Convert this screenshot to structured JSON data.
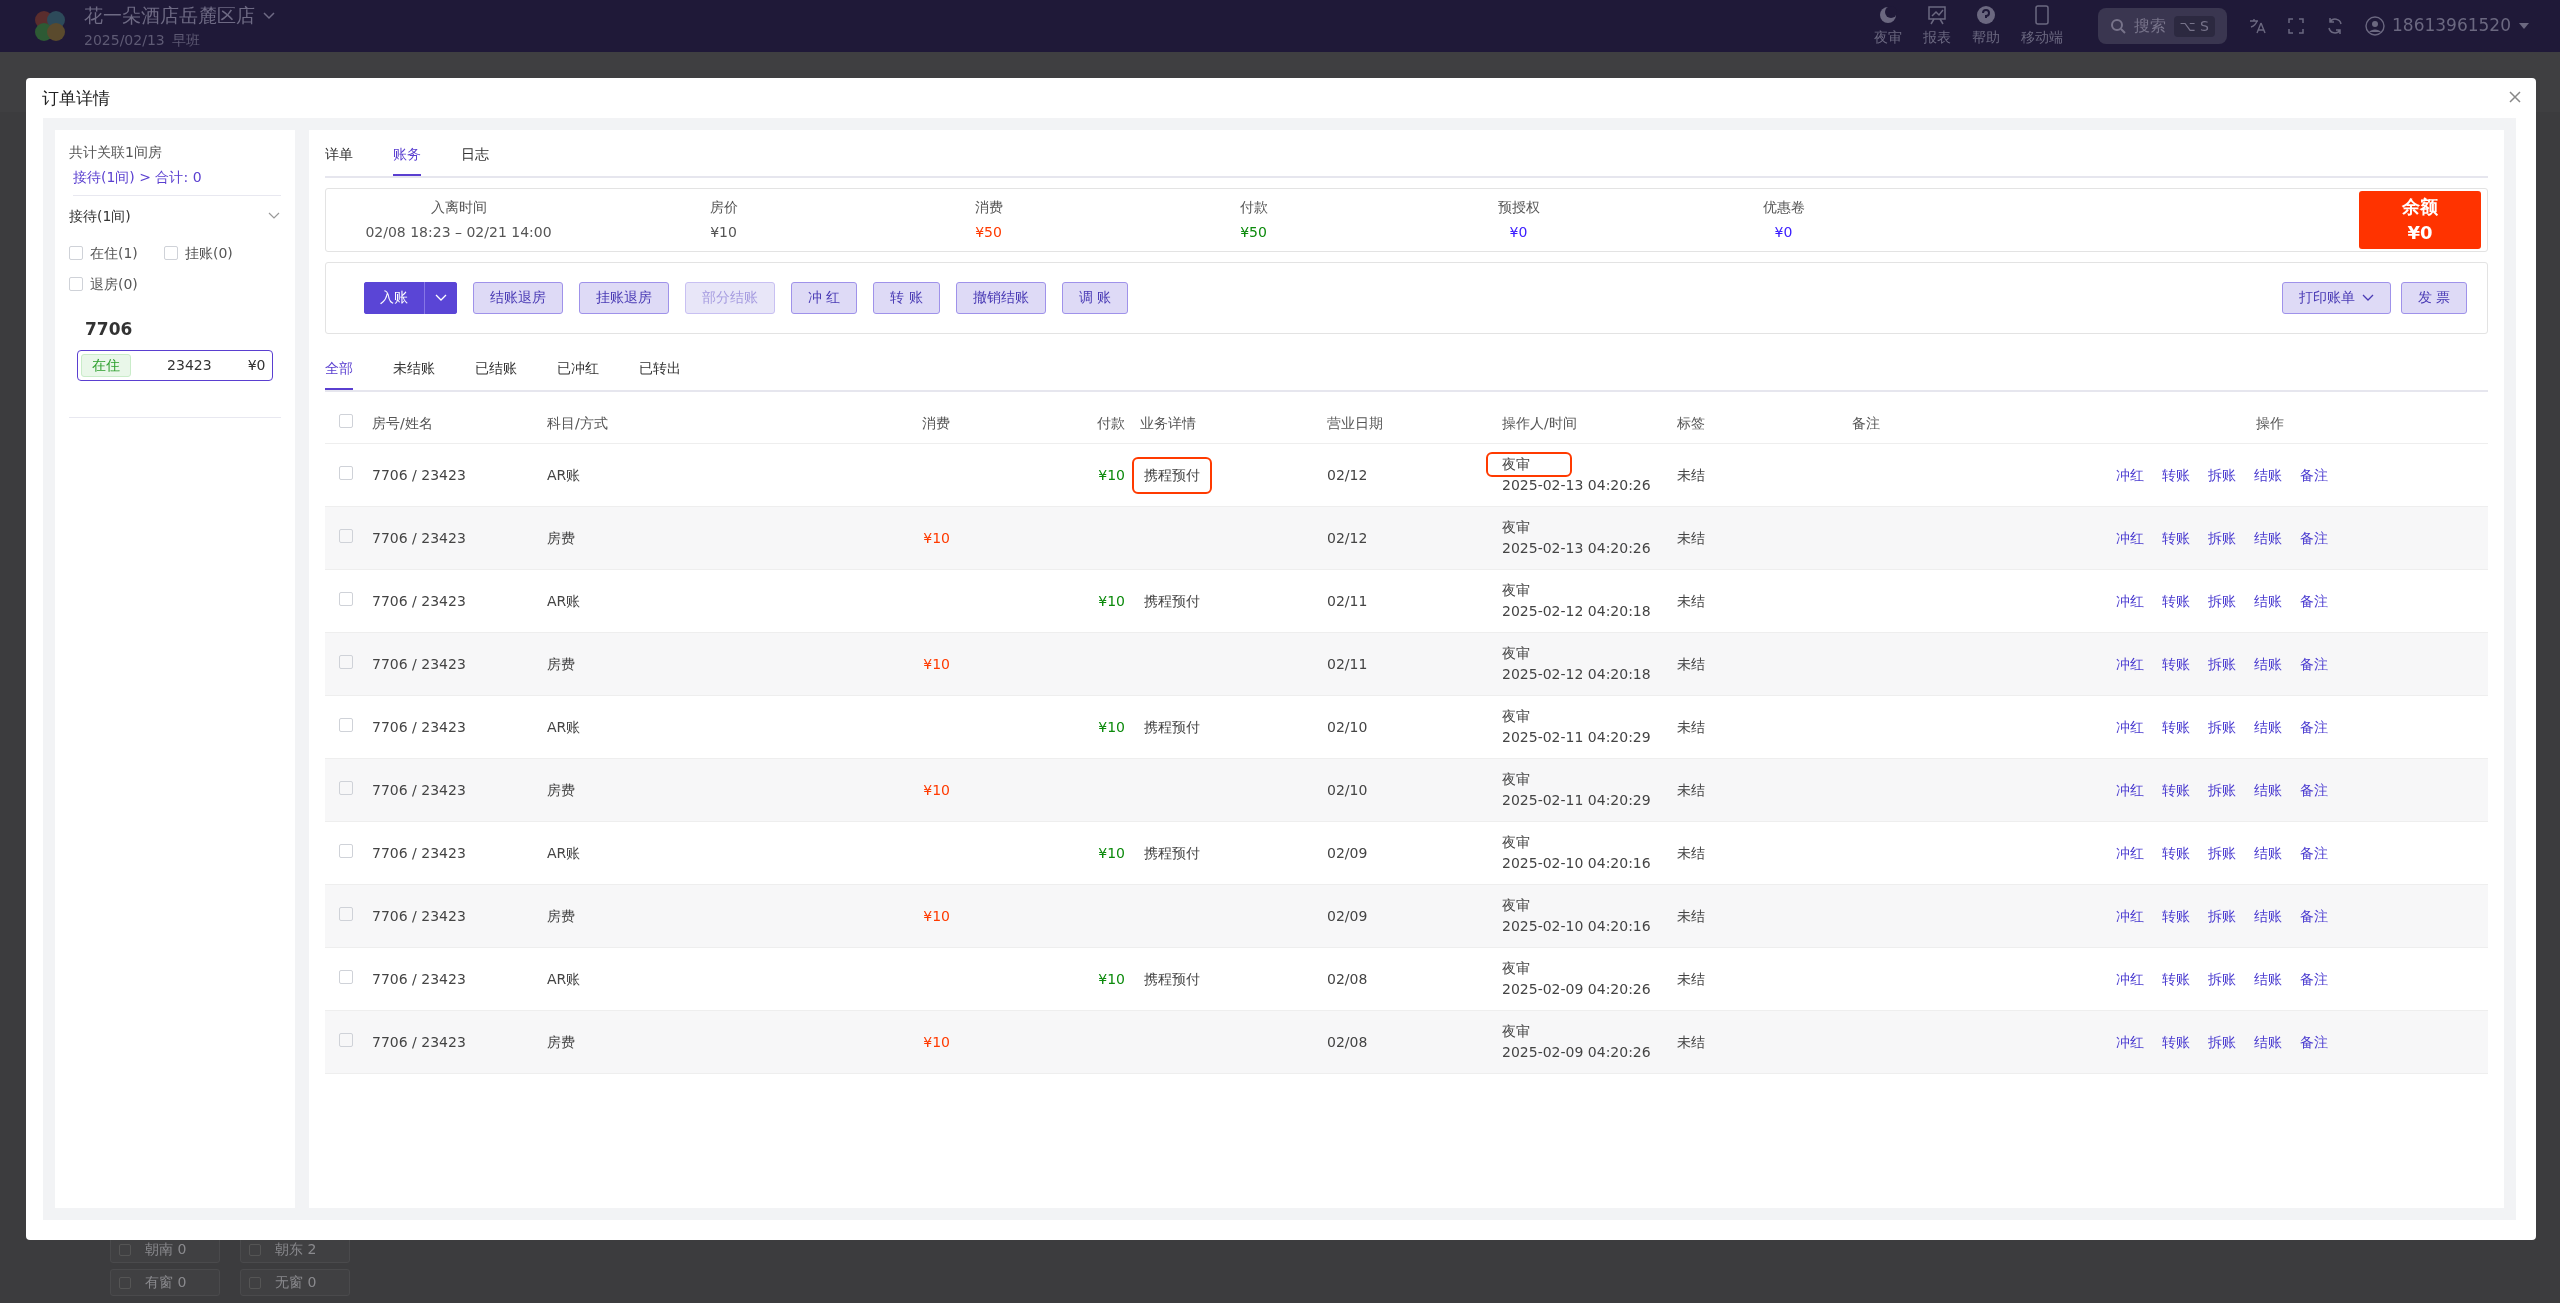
{
  "app": {
    "store_name": "花一朵酒店岳麓区店",
    "date": "2025/02/13",
    "shift": "早班",
    "nav": [
      {
        "label": "夜审"
      },
      {
        "label": "报表"
      },
      {
        "label": "帮助"
      },
      {
        "label": "移动端"
      }
    ],
    "search": {
      "label": "搜索",
      "shortcut": "⌥ S"
    },
    "user": "18613961520",
    "chips": [
      {
        "label": "朝南 0",
        "checked": false
      },
      {
        "label": "朝东 2",
        "checked": false
      },
      {
        "label": "有窗 0",
        "checked": false
      },
      {
        "label": "无窗 0",
        "checked": false
      }
    ]
  },
  "modal": {
    "title": "订单详情",
    "left": {
      "summary": "共计关联1间房",
      "breadcrumb": "接待(1间) > 合计: 0",
      "group": {
        "label": "接待(1间)",
        "expanded": true
      },
      "filters": [
        {
          "label": "在住(1)",
          "checked": false
        },
        {
          "label": "挂账(0)",
          "checked": false
        },
        {
          "label": "退房(0)",
          "checked": false
        }
      ],
      "room": "7706",
      "card": {
        "status": "在住",
        "name": "23423",
        "amount": "¥0",
        "selected": true
      }
    },
    "tabs": [
      {
        "label": "详单",
        "selected": false
      },
      {
        "label": "账务",
        "selected": true
      },
      {
        "label": "日志",
        "selected": false
      }
    ],
    "summary": [
      {
        "label": "入离时间",
        "value": "02/08 18:23 – 02/21 14:00",
        "kind": "plain"
      },
      {
        "label": "房价",
        "value": "¥10",
        "kind": "plain"
      },
      {
        "label": "消费",
        "value": "¥50",
        "kind": "consume"
      },
      {
        "label": "付款",
        "value": "¥50",
        "kind": "pay"
      },
      {
        "label": "预授权",
        "value": "¥0",
        "kind": "info"
      },
      {
        "label": "优惠卷",
        "value": "¥0",
        "kind": "info"
      }
    ],
    "balance": {
      "label": "余额",
      "value": "¥0"
    },
    "entry_button": "入账",
    "actions": [
      {
        "label": "结账退房",
        "disabled": false
      },
      {
        "label": "挂账退房",
        "disabled": false
      },
      {
        "label": "部分结账",
        "disabled": true
      },
      {
        "label": "冲 红",
        "disabled": false
      },
      {
        "label": "转 账",
        "disabled": false
      },
      {
        "label": "撤销结账",
        "disabled": false
      },
      {
        "label": "调 账",
        "disabled": false
      }
    ],
    "right_actions": [
      {
        "label": "打印账单",
        "dropdown": true
      },
      {
        "label": "发 票",
        "dropdown": false
      }
    ],
    "filters": [
      {
        "label": "全部",
        "selected": true
      },
      {
        "label": "未结账",
        "selected": false
      },
      {
        "label": "已结账",
        "selected": false
      },
      {
        "label": "已冲红",
        "selected": false
      },
      {
        "label": "已转出",
        "selected": false
      }
    ],
    "table": {
      "select_all": false,
      "columns": [
        "房号/姓名",
        "科目/方式",
        "消费",
        "付款",
        "业务详情",
        "营业日期",
        "操作人/时间",
        "标签",
        "备注",
        "操作"
      ],
      "rows": [
        {
          "checked": false,
          "room": "7706 / 23423",
          "item": "AR账",
          "pay": "¥10",
          "detail": "携程预付",
          "date": "02/12",
          "operator": "夜审",
          "time": "2025-02-13 04:20:26",
          "tag": "未结",
          "highlighted": true,
          "actions": [
            "冲红",
            "转账",
            "拆账",
            "结账",
            "备注"
          ]
        },
        {
          "checked": false,
          "room": "7706 / 23423",
          "item": "房费",
          "consume": "¥10",
          "date": "02/12",
          "operator": "夜审",
          "time": "2025-02-13 04:20:26",
          "tag": "未结",
          "highlighted": false,
          "actions": [
            "冲红",
            "转账",
            "拆账",
            "结账",
            "备注"
          ]
        },
        {
          "checked": false,
          "room": "7706 / 23423",
          "item": "AR账",
          "pay": "¥10",
          "detail": "携程预付",
          "date": "02/11",
          "operator": "夜审",
          "time": "2025-02-12 04:20:18",
          "tag": "未结",
          "highlighted": false,
          "actions": [
            "冲红",
            "转账",
            "拆账",
            "结账",
            "备注"
          ]
        },
        {
          "checked": false,
          "room": "7706 / 23423",
          "item": "房费",
          "consume": "¥10",
          "date": "02/11",
          "operator": "夜审",
          "time": "2025-02-12 04:20:18",
          "tag": "未结",
          "highlighted": false,
          "actions": [
            "冲红",
            "转账",
            "拆账",
            "结账",
            "备注"
          ]
        },
        {
          "checked": false,
          "room": "7706 / 23423",
          "item": "AR账",
          "pay": "¥10",
          "detail": "携程预付",
          "date": "02/10",
          "operator": "夜审",
          "time": "2025-02-11 04:20:29",
          "tag": "未结",
          "highlighted": false,
          "actions": [
            "冲红",
            "转账",
            "拆账",
            "结账",
            "备注"
          ]
        },
        {
          "checked": false,
          "room": "7706 / 23423",
          "item": "房费",
          "consume": "¥10",
          "date": "02/10",
          "operator": "夜审",
          "time": "2025-02-11 04:20:29",
          "tag": "未结",
          "highlighted": false,
          "actions": [
            "冲红",
            "转账",
            "拆账",
            "结账",
            "备注"
          ]
        },
        {
          "checked": false,
          "room": "7706 / 23423",
          "item": "AR账",
          "pay": "¥10",
          "detail": "携程预付",
          "date": "02/09",
          "operator": "夜审",
          "time": "2025-02-10 04:20:16",
          "tag": "未结",
          "highlighted": false,
          "actions": [
            "冲红",
            "转账",
            "拆账",
            "结账",
            "备注"
          ]
        },
        {
          "checked": false,
          "room": "7706 / 23423",
          "item": "房费",
          "consume": "¥10",
          "date": "02/09",
          "operator": "夜审",
          "time": "2025-02-10 04:20:16",
          "tag": "未结",
          "highlighted": false,
          "actions": [
            "冲红",
            "转账",
            "拆账",
            "结账",
            "备注"
          ]
        },
        {
          "checked": false,
          "room": "7706 / 23423",
          "item": "AR账",
          "pay": "¥10",
          "detail": "携程预付",
          "date": "02/08",
          "operator": "夜审",
          "time": "2025-02-09 04:20:26",
          "tag": "未结",
          "highlighted": false,
          "actions": [
            "冲红",
            "转账",
            "拆账",
            "结账",
            "备注"
          ]
        },
        {
          "checked": false,
          "room": "7706 / 23423",
          "item": "房费",
          "consume": "¥10",
          "date": "02/08",
          "operator": "夜审",
          "time": "2025-02-09 04:20:26",
          "tag": "未结",
          "highlighted": false,
          "actions": [
            "冲红",
            "转账",
            "拆账",
            "结账",
            "备注"
          ]
        }
      ]
    }
  }
}
